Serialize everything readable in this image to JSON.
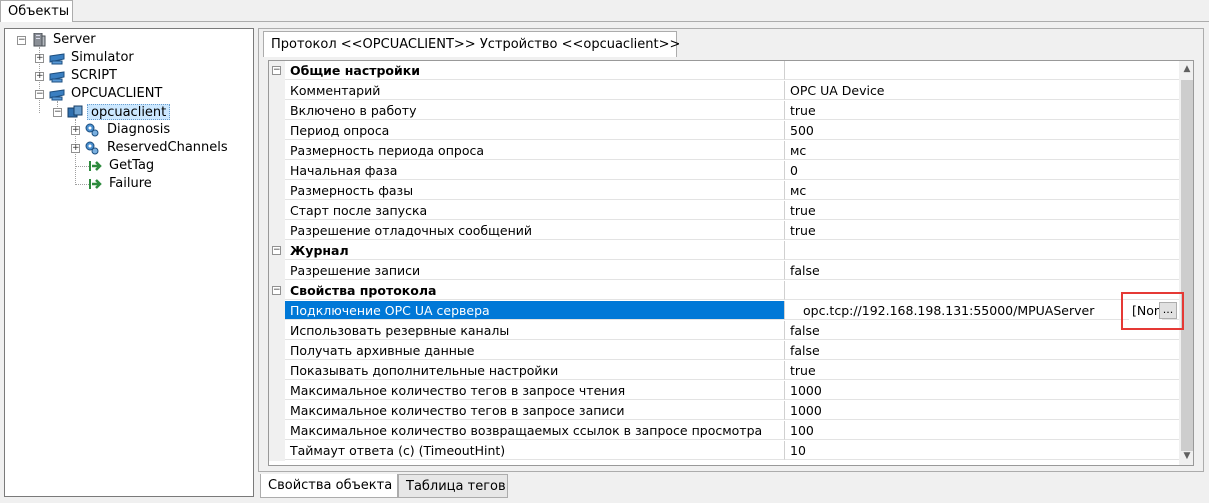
{
  "top_tab": {
    "label": "Объекты"
  },
  "tree": {
    "server": "Server",
    "simulator": "Simulator",
    "script": "SCRIPT",
    "opcuaclient": "OPCUACLIENT",
    "device": "opcuaclient",
    "diagnosis": "Diagnosis",
    "reserved": "ReservedChannels",
    "gettag": "GetTag",
    "failure": "Failure"
  },
  "protocol_tab": {
    "label": "Протокол <<OPCUACLIENT>> Устройство <<opcuaclient>>"
  },
  "grid": {
    "rows": [
      {
        "name": "Общие настройки",
        "value": "",
        "category": true
      },
      {
        "name": "Комментарий",
        "value": "OPC UA Device"
      },
      {
        "name": "Включено в работу",
        "value": "true"
      },
      {
        "name": "Период опроса",
        "value": "500"
      },
      {
        "name": "Размерность периода опроса",
        "value": "мс"
      },
      {
        "name": "Начальная фаза",
        "value": "0"
      },
      {
        "name": "Размерность фазы",
        "value": "мс"
      },
      {
        "name": "Старт после запуска",
        "value": "true"
      },
      {
        "name": "Разрешение отладочных сообщений",
        "value": "true"
      },
      {
        "name": "Журнал",
        "value": "",
        "category": true
      },
      {
        "name": "Разрешение записи",
        "value": "false"
      },
      {
        "name": "Свойства протокола",
        "value": "",
        "category": true
      },
      {
        "name": "Подключение OPC UA сервера",
        "value": "opc.tcp://192.168.198.131:55000/MPUAServer",
        "selected": true
      },
      {
        "name": "Использовать резервные каналы",
        "value": "false"
      },
      {
        "name": "Получать архивные данные",
        "value": "false"
      },
      {
        "name": "Показывать дополнительные настройки",
        "value": "true"
      },
      {
        "name": "Максимальное количество тегов в запросе чтения",
        "value": "1000"
      },
      {
        "name": "Максимальное количество тегов в запросе записи",
        "value": "1000"
      },
      {
        "name": "Максимальное количество возвращаемых ссылок в запросе просмотра",
        "value": "100"
      },
      {
        "name": "Таймаут ответа (с) (TimeoutHint)",
        "value": "10"
      }
    ],
    "connection_suffix": "[Non",
    "ellipsis_label": "..."
  },
  "bottom_tabs": {
    "properties": "Свойства объекта",
    "tags": "Таблица тегов"
  },
  "colors": {
    "selection": "#0078d7",
    "highlight_box": "#e53935"
  }
}
